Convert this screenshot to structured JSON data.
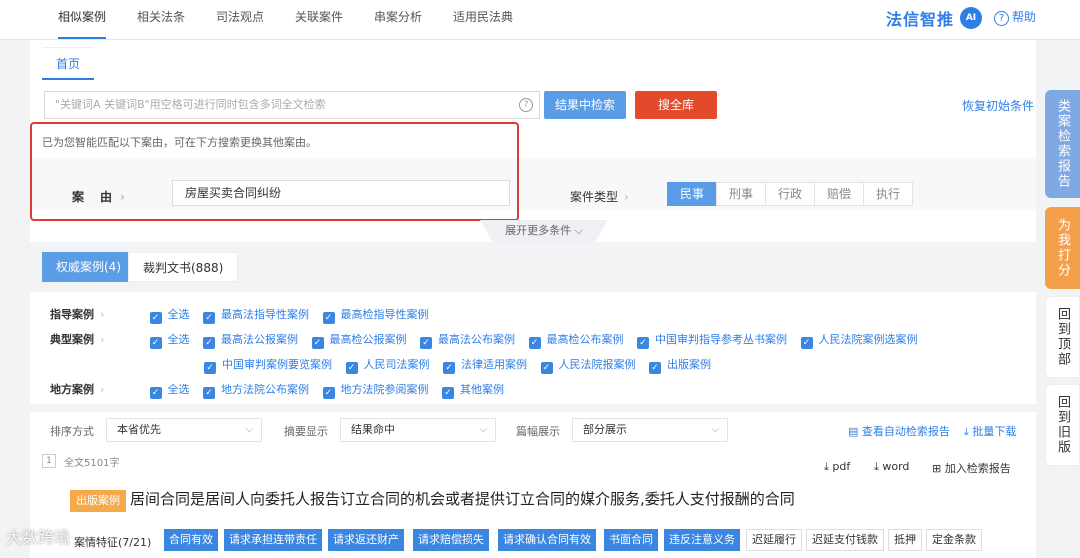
{
  "nav": {
    "tabs": [
      "相似案例",
      "相关法条",
      "司法观点",
      "关联案件",
      "串案分析",
      "适用民法典"
    ],
    "brand": "法信智推",
    "brand_logo": "AI",
    "help": "帮助"
  },
  "panel": {
    "breadcrumb": "首页",
    "search_placeholder": "\"关键词A 关键词B\"用空格可进行同时包含多词全文检索",
    "btn_in_results": "结果中检索",
    "btn_search_all": "搜全库",
    "reset": "恢复初始条件",
    "hint": "已为您智能匹配以下案由，可在下方搜索更换其他案由。",
    "cause_label": "案　由",
    "cause_value": "房屋买卖合同纠纷",
    "case_type_label": "案件类型",
    "case_types": [
      "民事",
      "刑事",
      "行政",
      "赔偿",
      "执行"
    ],
    "expand": "展开更多条件"
  },
  "result_tabs": {
    "authoritative": "权威案例(4)",
    "judgments": "裁判文书(888)"
  },
  "filters": {
    "guide_label": "指导案例",
    "guide_items": [
      "全选",
      "最高法指导性案例",
      "最高检指导性案例"
    ],
    "typical_label": "典型案例",
    "typical_items_1": [
      "全选",
      "最高法公报案例",
      "最高检公报案例",
      "最高法公布案例",
      "最高检公布案例",
      "中国审判指导参考丛书案例",
      "人民法院案例选案例"
    ],
    "typical_items_2": [
      "中国审判案例要览案例",
      "人民司法案例",
      "法律适用案例",
      "人民法院报案例",
      "出版案例"
    ],
    "local_label": "地方案例",
    "local_items": [
      "全选",
      "地方法院公布案例",
      "地方法院参阅案例",
      "其他案例"
    ]
  },
  "sortbar": {
    "sort_label": "排序方式",
    "sort_value": "本省优先",
    "summary_label": "摘要显示",
    "summary_value": "结果命中",
    "length_label": "篇幅展示",
    "length_value": "部分展示",
    "auto_report": "查看自动检索报告",
    "batch_download": "批量下载"
  },
  "result": {
    "index": "1",
    "fulltext": "全文5101字",
    "pdf": "pdf",
    "word": "word",
    "add_report": "加入检索报告",
    "tag": "出版案例",
    "title": "居间合同是居间人向委托人报告订立合同的机会或者提供订立合同的媒介服务,委托人支付报酬的合同",
    "kw_label": "案情特征(7/21)",
    "kw_blue": [
      "合同有效",
      "请求承担连带责任",
      "请求返还财产",
      "请求赔偿损失",
      "请求确认合同有效",
      "书面合同",
      "违反注意义务"
    ],
    "kw_gray": [
      "迟延履行",
      "迟延支付钱款",
      "抵押",
      "定金条款"
    ]
  },
  "watermark": "大数跨境",
  "side": {
    "s1": "类案检索报告",
    "s2": "为我打分",
    "s3": "回到顶部",
    "s4": "回到旧版"
  }
}
